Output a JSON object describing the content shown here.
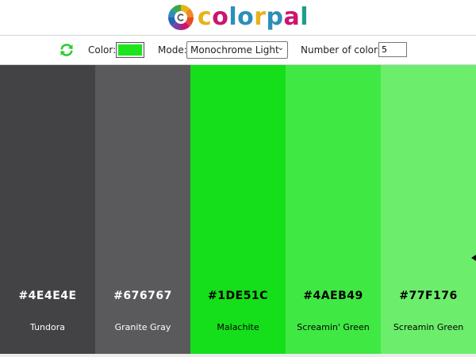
{
  "header": {
    "logo_icon": "color-wheel-icon",
    "logo_letters": [
      {
        "ch": "c",
        "color": "#e8b21a"
      },
      {
        "ch": "o",
        "color": "#c9166e"
      },
      {
        "ch": "l",
        "color": "#2c8fb8"
      },
      {
        "ch": "o",
        "color": "#2c8fb8"
      },
      {
        "ch": "r",
        "color": "#e8b21a"
      },
      {
        "ch": "p",
        "color": "#2c8fb8"
      },
      {
        "ch": "a",
        "color": "#c9166e"
      },
      {
        "ch": "l",
        "color": "#1f9e8a"
      }
    ]
  },
  "toolbar": {
    "refresh_icon": "refresh-icon",
    "refresh_color": "#2ecc2e",
    "color_label": "Color:",
    "color_value": "#1DE51C",
    "mode_label": "Mode:",
    "mode_value": "Monochrome Light",
    "num_label": "Number of colors:",
    "num_value": "5"
  },
  "palette": [
    {
      "hex": "#4E4E4E",
      "name": "Tundora",
      "bg": "#434244",
      "text_color": "#ffffff"
    },
    {
      "hex": "#676767",
      "name": "Granite Gray",
      "bg": "#5a595c",
      "text_color": "#ffffff"
    },
    {
      "hex": "#1DE51C",
      "name": "Malachite",
      "bg": "#15df1b",
      "text_color": "#000000"
    },
    {
      "hex": "#4AEB49",
      "name": "Screamin' Green",
      "bg": "#40e843",
      "text_color": "#000000"
    },
    {
      "hex": "#77F176",
      "name": "Screamin Green",
      "bg": "#6cee6c",
      "text_color": "#000000"
    }
  ]
}
